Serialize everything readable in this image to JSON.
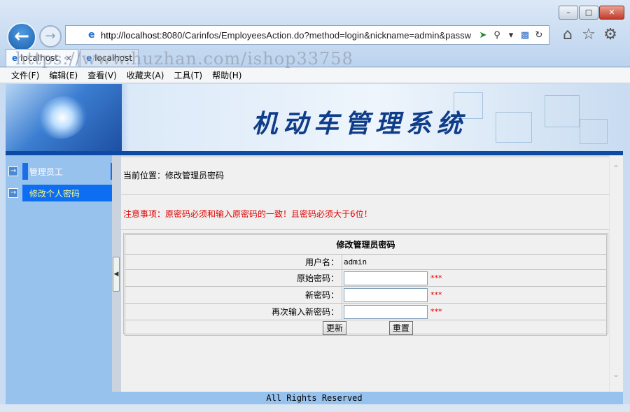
{
  "window": {
    "min_glyph": "–",
    "max_glyph": "□",
    "close_glyph": "✕"
  },
  "browser": {
    "url_host": "http://localhost",
    "url_rest": ":8080/Carinfos/EmployeesAction.do?method=login&nickname=admin&passw",
    "tabs": [
      {
        "label": "localhost",
        "active": true
      },
      {
        "label": "localhost",
        "active": false
      }
    ],
    "watermark": "https://www.huzhan.com/ishop33758",
    "menu": [
      "文件(F)",
      "编辑(E)",
      "查看(V)",
      "收藏夹(A)",
      "工具(T)",
      "帮助(H)"
    ],
    "icons": [
      "back-icon",
      "forward-icon",
      "search-icon",
      "refresh-icon",
      "home-icon",
      "favorites-star-icon",
      "settings-gear-icon"
    ]
  },
  "banner": {
    "title": "机动车管理系统"
  },
  "sidebar": {
    "items": [
      {
        "label": "管理员工"
      },
      {
        "label": "修改个人密码",
        "selected": true
      }
    ]
  },
  "main": {
    "breadcrumb": "当前位置：修改管理员密码",
    "notice": "注意事项：原密码必须和输入原密码的一致！且密码必须大于6位！",
    "form": {
      "title": "修改管理员密码",
      "username_label": "用户名：",
      "username_value": "admin",
      "old_password_label": "原始密码：",
      "new_password_label": "新密码：",
      "confirm_password_label": "再次输入新密码：",
      "required_mark": "***",
      "submit_label": "更新",
      "reset_label": "重置"
    }
  },
  "footer": {
    "text": "All Rights Reserved"
  },
  "colors": {
    "sidebar_bg": "#98c2ee",
    "selected_item_bg": "#0d6ef2",
    "notice_red": "#e00000",
    "title_blue": "#0f3d89"
  }
}
